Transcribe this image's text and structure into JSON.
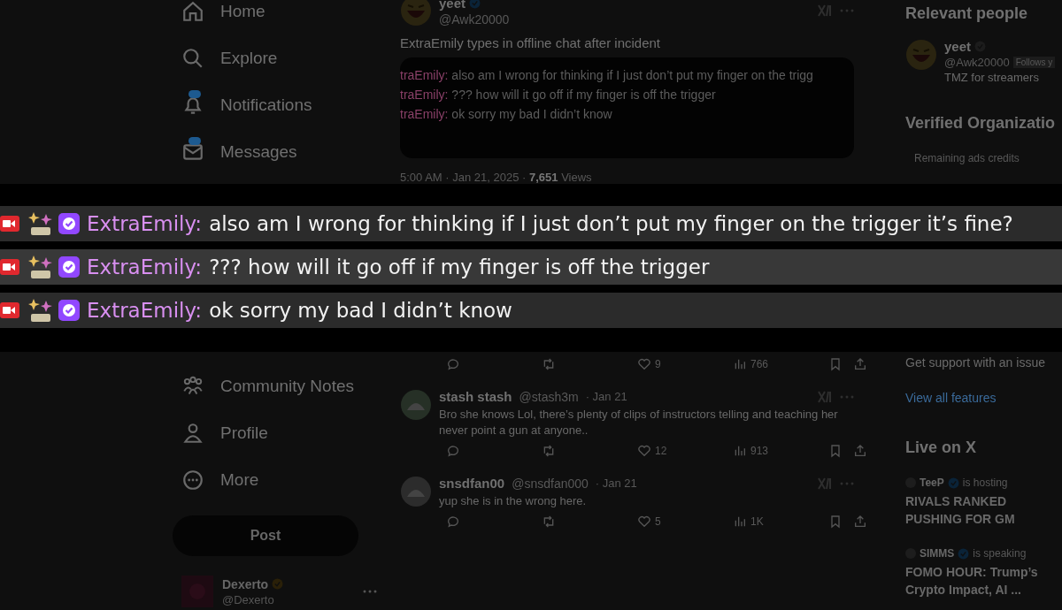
{
  "sidebar": {
    "items": [
      {
        "label": "Home",
        "badge": false
      },
      {
        "label": "Explore",
        "badge": false
      },
      {
        "label": "Notifications",
        "badge": true
      },
      {
        "label": "Messages",
        "badge": true
      }
    ],
    "lower_items": [
      {
        "label": "Community Notes"
      },
      {
        "label": "Profile"
      },
      {
        "label": "More"
      }
    ],
    "post_button": "Post",
    "account": {
      "name": "Dexerto",
      "handle": "@Dexerto"
    }
  },
  "post": {
    "author": "yeet",
    "handle": "@Awk20000",
    "text": "ExtraEmily types in offline chat after incident",
    "image_lines": [
      {
        "user": "traEmily:",
        "message": "also am I wrong for thinking if I just don’t put my finger on the trigg"
      },
      {
        "user": "traEmily:",
        "message": "??? how will it go off if my finger is off the trigger"
      },
      {
        "user": "traEmily:",
        "message": "ok sorry my bad I didn’t know"
      }
    ],
    "time": "5:00 AM · Jan 21, 2025 ·",
    "views": "7,651",
    "views_label": "Views",
    "actions": {
      "likes": "9",
      "views": "766"
    }
  },
  "chat_overlay": {
    "lines": [
      {
        "user": "ExtraEmily:",
        "message": "also am I wrong for thinking if I just don’t put my finger on the trigger it’s fine?"
      },
      {
        "user": "ExtraEmily:",
        "message": "??? how will it go off if my finger is off the trigger"
      },
      {
        "user": "ExtraEmily:",
        "message": "ok sorry my bad I didn’t know"
      }
    ]
  },
  "replies": [
    {
      "author": "stash stash",
      "handle": "@stash3m",
      "date": "· Jan 21",
      "text": "Bro she knows Lol, there’s plenty of clips of instructors telling and teaching her never point a gun at anyone..",
      "likes": "12",
      "views": "913"
    },
    {
      "author": "snsdfan00",
      "handle": "@snsdfan000",
      "date": "· Jan 21",
      "text": "yup she is in the wrong here.",
      "likes": "5",
      "views": "1K"
    }
  ],
  "right": {
    "relevant_title": "Relevant people",
    "person": {
      "name": "yeet",
      "handle": "@Awk20000",
      "follows": "Follows y",
      "bio": "TMZ for streamers"
    },
    "verified_title": "Verified Organizatio",
    "ads_line": "Remaining ads credits",
    "support": "Get support with an issue",
    "view_all": "View all features",
    "live_title": "Live on X",
    "live": [
      {
        "host": "TeeP",
        "status": "is hosting",
        "title": "RIVALS RANKED PUSHING FOR GM"
      },
      {
        "host": "SIMMS",
        "status": "is speaking",
        "title": "FOMO HOUR: Trump’s Crypto Impact, AI ..."
      }
    ]
  }
}
